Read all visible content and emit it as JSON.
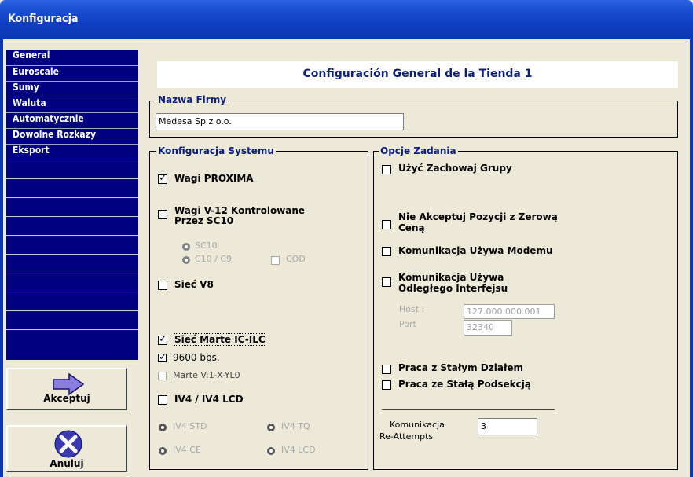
{
  "window": {
    "title": "Konfiguracja"
  },
  "sidebar": {
    "items": [
      "General",
      "Euroscale",
      "Sumy",
      "Waluta",
      "Automatycznie",
      "Dowolne Rozkazy",
      "Eksport"
    ]
  },
  "buttons": {
    "accept": "Akceptuj",
    "cancel": "Anuluj"
  },
  "header": {
    "title": "Configuración General de la Tienda 1"
  },
  "company": {
    "group_title": "Nazwa Firmy",
    "name": "Medesa Sp z o.o."
  },
  "system": {
    "group_title": "Konfiguracja Systemu",
    "wagi_proxima": {
      "label": "Wagi PROXIMA",
      "checked": true
    },
    "wagi_v12": {
      "label_line1": "Wagi V-12 Kontrolowane",
      "label_line2": "Przez SC10",
      "checked": false
    },
    "sc10": "SC10",
    "c10": "C10 / C9",
    "cod": "COD",
    "siec_v8": {
      "label": "Sieć V8",
      "checked": false
    },
    "siec_marte": {
      "label": "Sieć Marte IC-ILC",
      "checked": true
    },
    "bps": {
      "label": "9600 bps.",
      "checked": true
    },
    "marte_v": {
      "label": "Marte V:1-X-YL0",
      "checked": false
    },
    "iv4": {
      "label": "IV4 / IV4 LCD",
      "checked": false
    },
    "iv4_std": "IV4 STD",
    "iv4_tq": "IV4 TQ",
    "iv4_ce": "IV4 CE",
    "iv4_lcd": "IV4 LCD"
  },
  "options": {
    "group_title": "Opcje Zadania",
    "zachowaj": {
      "label": "Użyć Zachowaj Grupy",
      "checked": false
    },
    "zerowa": {
      "label_line1": "Nie Akceptuj Pozycji z Zerową",
      "label_line2": "Ceną",
      "checked": false
    },
    "modem": {
      "label": "Komunikacja Używa Modemu",
      "checked": false
    },
    "remote": {
      "label_line1": "Komunikacja Używa",
      "label_line2": "Odległego Interfejsu",
      "checked": false
    },
    "host_label": "Host :",
    "host_value": "127.000.000.001",
    "port_label": "Port",
    "port_value": "32340",
    "dzial": {
      "label": "Praca z Stałym Działem",
      "checked": false
    },
    "podsekcja": {
      "label": "Praca ze Stałą Podsekcją",
      "checked": false
    },
    "reattempts_label_1": "Komunikacja",
    "reattempts_label_2": "Re-Attempts",
    "reattempts_value": "3"
  }
}
